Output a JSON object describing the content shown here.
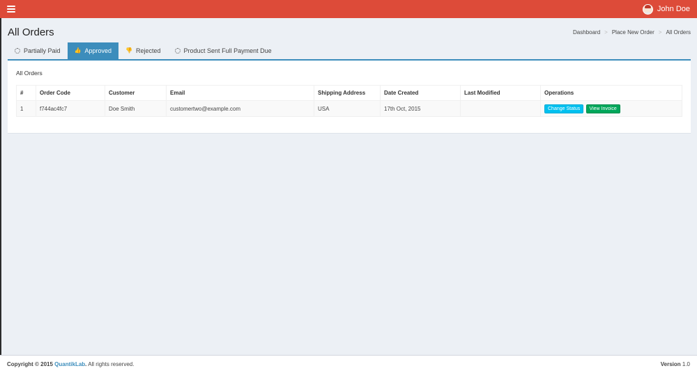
{
  "header": {
    "user_name": "John Doe"
  },
  "page": {
    "title": "All Orders",
    "breadcrumb": [
      "Dashboard",
      "Place New Order",
      "All Orders"
    ]
  },
  "tabs": [
    {
      "label": "Partially Paid",
      "icon": "spinner-icon",
      "active": false
    },
    {
      "label": "Approved",
      "icon": "thumbs-up-icon",
      "active": true
    },
    {
      "label": "Rejected",
      "icon": "thumbs-down-icon",
      "active": false
    },
    {
      "label": "Product Sent Full Payment Due",
      "icon": "spinner-icon",
      "active": false
    }
  ],
  "box": {
    "title": "All Orders"
  },
  "table": {
    "columns": [
      "#",
      "Order Code",
      "Customer",
      "Email",
      "Shipping Address",
      "Date Created",
      "Last Modified",
      "Operations"
    ],
    "rows": [
      {
        "num": "1",
        "order_code": "f744ac4fc7",
        "customer": "Doe Smith",
        "email": "customertwo@example.com",
        "shipping_address": "USA",
        "date_created": "17th Oct, 2015",
        "last_modified": "",
        "actions": [
          "Change Status",
          "View Invoice"
        ]
      }
    ]
  },
  "footer": {
    "copyright_prefix": "Copyright © 2015",
    "company": "QuantikLab",
    "rights": ". All rights reserved.",
    "version_label": "Version",
    "version": "1.0"
  },
  "colors": {
    "header_red": "#dd4b39",
    "accent_blue": "#3c8dbc",
    "info": "#00c0ef",
    "success": "#00a65a"
  }
}
